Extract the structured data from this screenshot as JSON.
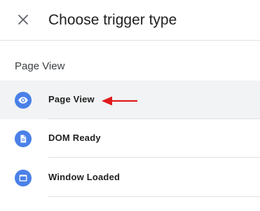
{
  "header": {
    "title": "Choose trigger type",
    "close_icon": "close-icon"
  },
  "section": {
    "label": "Page View"
  },
  "items": [
    {
      "label": "Page View",
      "icon": "eye-icon",
      "selected": true
    },
    {
      "label": "DOM Ready",
      "icon": "document-icon",
      "selected": false
    },
    {
      "label": "Window Loaded",
      "icon": "window-icon",
      "selected": false
    }
  ],
  "colors": {
    "icon_circle": "#4a80e8",
    "selected_bg": "#f1f3f4",
    "annotation_arrow": "#e0191a"
  }
}
